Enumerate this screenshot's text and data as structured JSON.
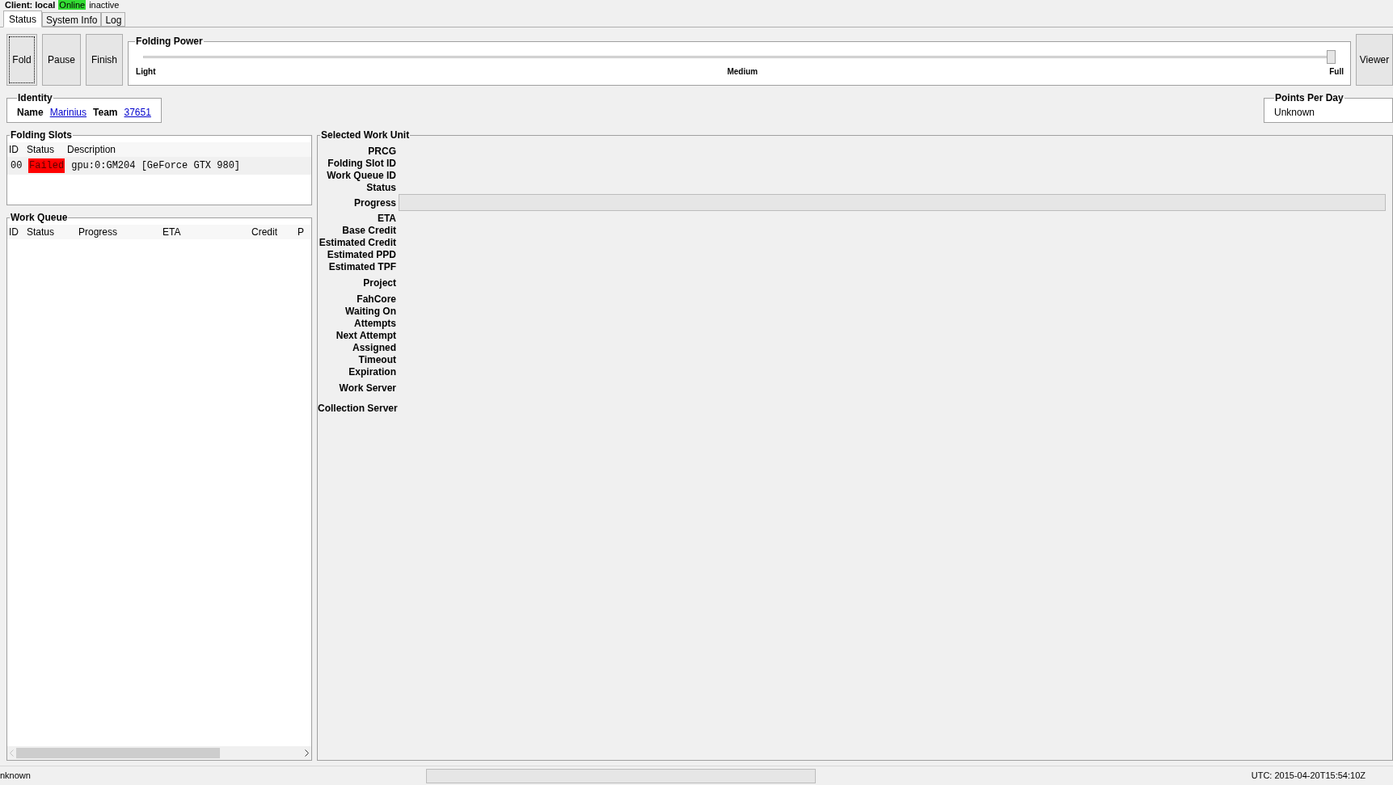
{
  "client": {
    "label": "Client: local",
    "status": "Online",
    "state": "inactive"
  },
  "tabs": [
    {
      "label": "Status",
      "selected": true
    },
    {
      "label": "System Info",
      "selected": false
    },
    {
      "label": "Log",
      "selected": false
    }
  ],
  "buttons": [
    {
      "label": "Fold",
      "focused": true
    },
    {
      "label": "Pause",
      "focused": false
    },
    {
      "label": "Finish",
      "focused": false
    }
  ],
  "folding_power": {
    "title": "Folding Power",
    "level": 1,
    "ticks": [
      "Light",
      "Medium",
      "Full"
    ]
  },
  "viewer_button": "Viewer",
  "identity": {
    "title": "Identity",
    "name_label": "Name",
    "name": "Marinius",
    "team_label": "Team",
    "team": "37651"
  },
  "points_per_day": {
    "title": "Points Per Day",
    "value": "Unknown"
  },
  "folding_slots": {
    "title": "Folding Slots",
    "columns": [
      "ID",
      "Status",
      "Description"
    ],
    "rows": [
      {
        "id": "00",
        "status": "Failed",
        "color": "#ff0000",
        "description": "gpu:0:GM204 [GeForce GTX 980]"
      }
    ]
  },
  "work_queue": {
    "title": "Work Queue",
    "columns": [
      "ID",
      "Status",
      "Progress",
      "ETA",
      "Credit",
      "P"
    ]
  },
  "selected_work_unit": {
    "title": "Selected Work Unit",
    "fields": [
      {
        "label": "PRCG",
        "kind": "text"
      },
      {
        "label": "Folding Slot ID",
        "kind": "text"
      },
      {
        "label": "Work Queue ID",
        "kind": "text"
      },
      {
        "label": "Status",
        "kind": "text"
      },
      {
        "label": "Progress",
        "kind": "bar",
        "level": 0
      },
      {
        "label": "ETA",
        "kind": "text"
      },
      {
        "label": "Base Credit",
        "kind": "text"
      },
      {
        "label": "Estimated Credit",
        "kind": "text"
      },
      {
        "label": "Estimated PPD",
        "kind": "text"
      },
      {
        "label": "Estimated TPF",
        "kind": "text"
      },
      {
        "label": "Project",
        "kind": "gap"
      },
      {
        "label": "FahCore",
        "kind": "gap"
      },
      {
        "label": "Waiting On",
        "kind": "text"
      },
      {
        "label": "Attempts",
        "kind": "text"
      },
      {
        "label": "Next Attempt",
        "kind": "text"
      },
      {
        "label": "Assigned",
        "kind": "text"
      },
      {
        "label": "Timeout",
        "kind": "text"
      },
      {
        "label": "Expiration",
        "kind": "text"
      },
      {
        "label": "Work Server",
        "kind": "gap"
      },
      {
        "label": "Collection Server",
        "kind": "wide"
      }
    ]
  },
  "status_bar": {
    "left": "nknown",
    "level": 0,
    "right": "UTC: 2015-04-20T15:54:10Z"
  }
}
